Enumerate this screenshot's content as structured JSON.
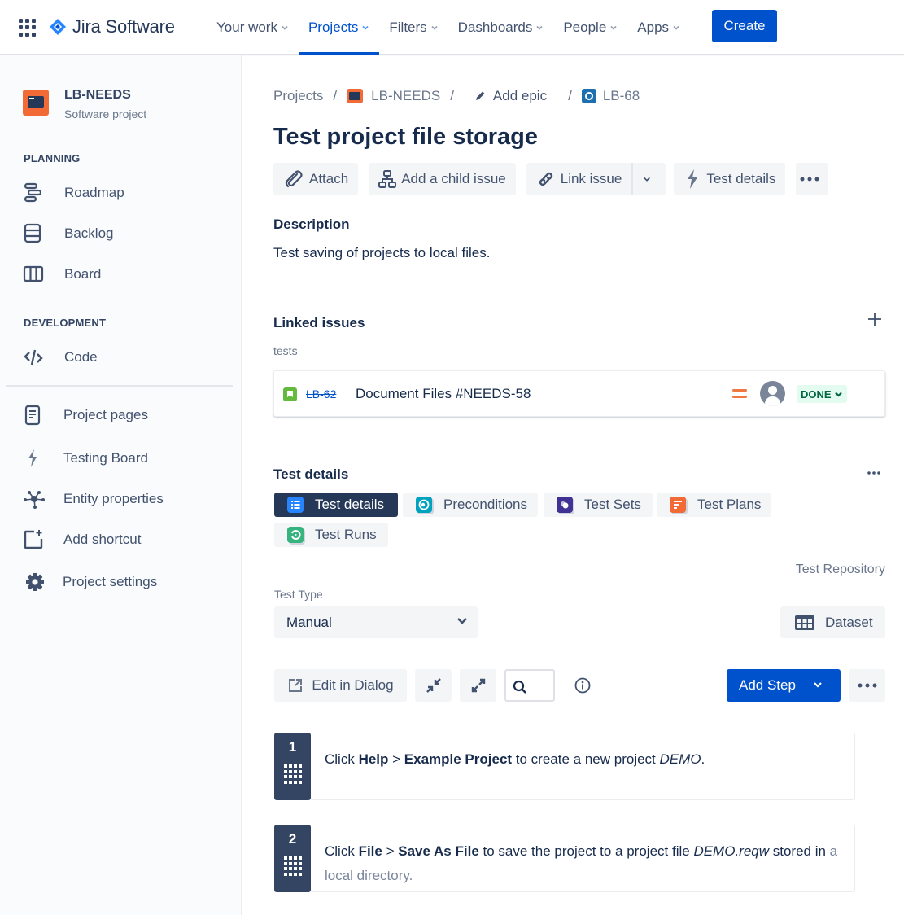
{
  "topbar": {
    "app_name": "Jira Software",
    "nav": [
      {
        "label": "Your work",
        "active": false
      },
      {
        "label": "Projects",
        "active": true
      },
      {
        "label": "Filters",
        "active": false
      },
      {
        "label": "Dashboards",
        "active": false
      },
      {
        "label": "People",
        "active": false
      },
      {
        "label": "Apps",
        "active": false
      }
    ],
    "create_label": "Create",
    "brand_color": "#0052cc"
  },
  "sidebar": {
    "project_name": "LB-NEEDS",
    "project_type": "Software project",
    "planning_title": "PLANNING",
    "planning_items": [
      {
        "label": "Roadmap",
        "icon": "roadmap-icon"
      },
      {
        "label": "Backlog",
        "icon": "backlog-icon"
      },
      {
        "label": "Board",
        "icon": "board-icon"
      }
    ],
    "development_title": "DEVELOPMENT",
    "development_items": [
      {
        "label": "Code",
        "icon": "code-icon"
      }
    ],
    "other_items": [
      {
        "label": "Project pages",
        "icon": "page-icon"
      },
      {
        "label": "Testing Board",
        "icon": "lightning-icon"
      },
      {
        "label": "Entity properties",
        "icon": "hub-icon"
      },
      {
        "label": "Add shortcut",
        "icon": "add-shortcut-icon"
      },
      {
        "label": "Project settings",
        "icon": "gear-icon"
      }
    ]
  },
  "breadcrumb": {
    "projects": "Projects",
    "project": "LB-NEEDS",
    "epic": "Add epic",
    "issue": "LB-68"
  },
  "issue": {
    "title": "Test project file storage",
    "toolbar": {
      "attach": "Attach",
      "add_child": "Add a child issue",
      "link_issue": "Link issue",
      "test_details": "Test details"
    },
    "description_heading": "Description",
    "description": "Test saving of projects to local files.",
    "linked_heading": "Linked issues",
    "linked_relation": "tests",
    "linked_issues": [
      {
        "key": "LB-62",
        "summary": "Document Files #NEEDS-58",
        "priority": "medium",
        "status": "DONE"
      }
    ]
  },
  "test_details": {
    "heading": "Test details",
    "tabs": [
      {
        "label": "Test details",
        "active": true,
        "color": "#2684ff"
      },
      {
        "label": "Preconditions",
        "active": false,
        "color": "#00a3bf"
      },
      {
        "label": "Test Sets",
        "active": false,
        "color": "#403294"
      },
      {
        "label": "Test Plans",
        "active": false,
        "color": "#f26b36"
      },
      {
        "label": "Test Runs",
        "active": false,
        "color": "#36b37e"
      }
    ],
    "repository_label": "Test Repository",
    "test_type_label": "Test Type",
    "test_type_value": "Manual",
    "dataset_label": "Dataset",
    "edit_dialog_label": "Edit in Dialog",
    "search_value": "",
    "add_step_label": "Add Step",
    "steps": [
      {
        "number": "1",
        "parts": [
          {
            "t": "Click ",
            "s": "n"
          },
          {
            "t": "Help",
            "s": "b"
          },
          {
            "t": " > ",
            "s": "n"
          },
          {
            "t": "Example Project",
            "s": "b"
          },
          {
            "t": " to create a new project ",
            "s": "n"
          },
          {
            "t": "DEMO",
            "s": "i"
          },
          {
            "t": ".",
            "s": "n"
          }
        ]
      },
      {
        "number": "2",
        "parts": [
          {
            "t": "Click ",
            "s": "n"
          },
          {
            "t": "File",
            "s": "b"
          },
          {
            "t": " > ",
            "s": "n"
          },
          {
            "t": "Save As File",
            "s": "b"
          },
          {
            "t": " to save the project to a project file ",
            "s": "n"
          },
          {
            "t": "DEMO.reqw",
            "s": "i"
          },
          {
            "t": " stored in ",
            "s": "n"
          },
          {
            "t": "a local directory.",
            "s": "f"
          }
        ]
      }
    ]
  }
}
